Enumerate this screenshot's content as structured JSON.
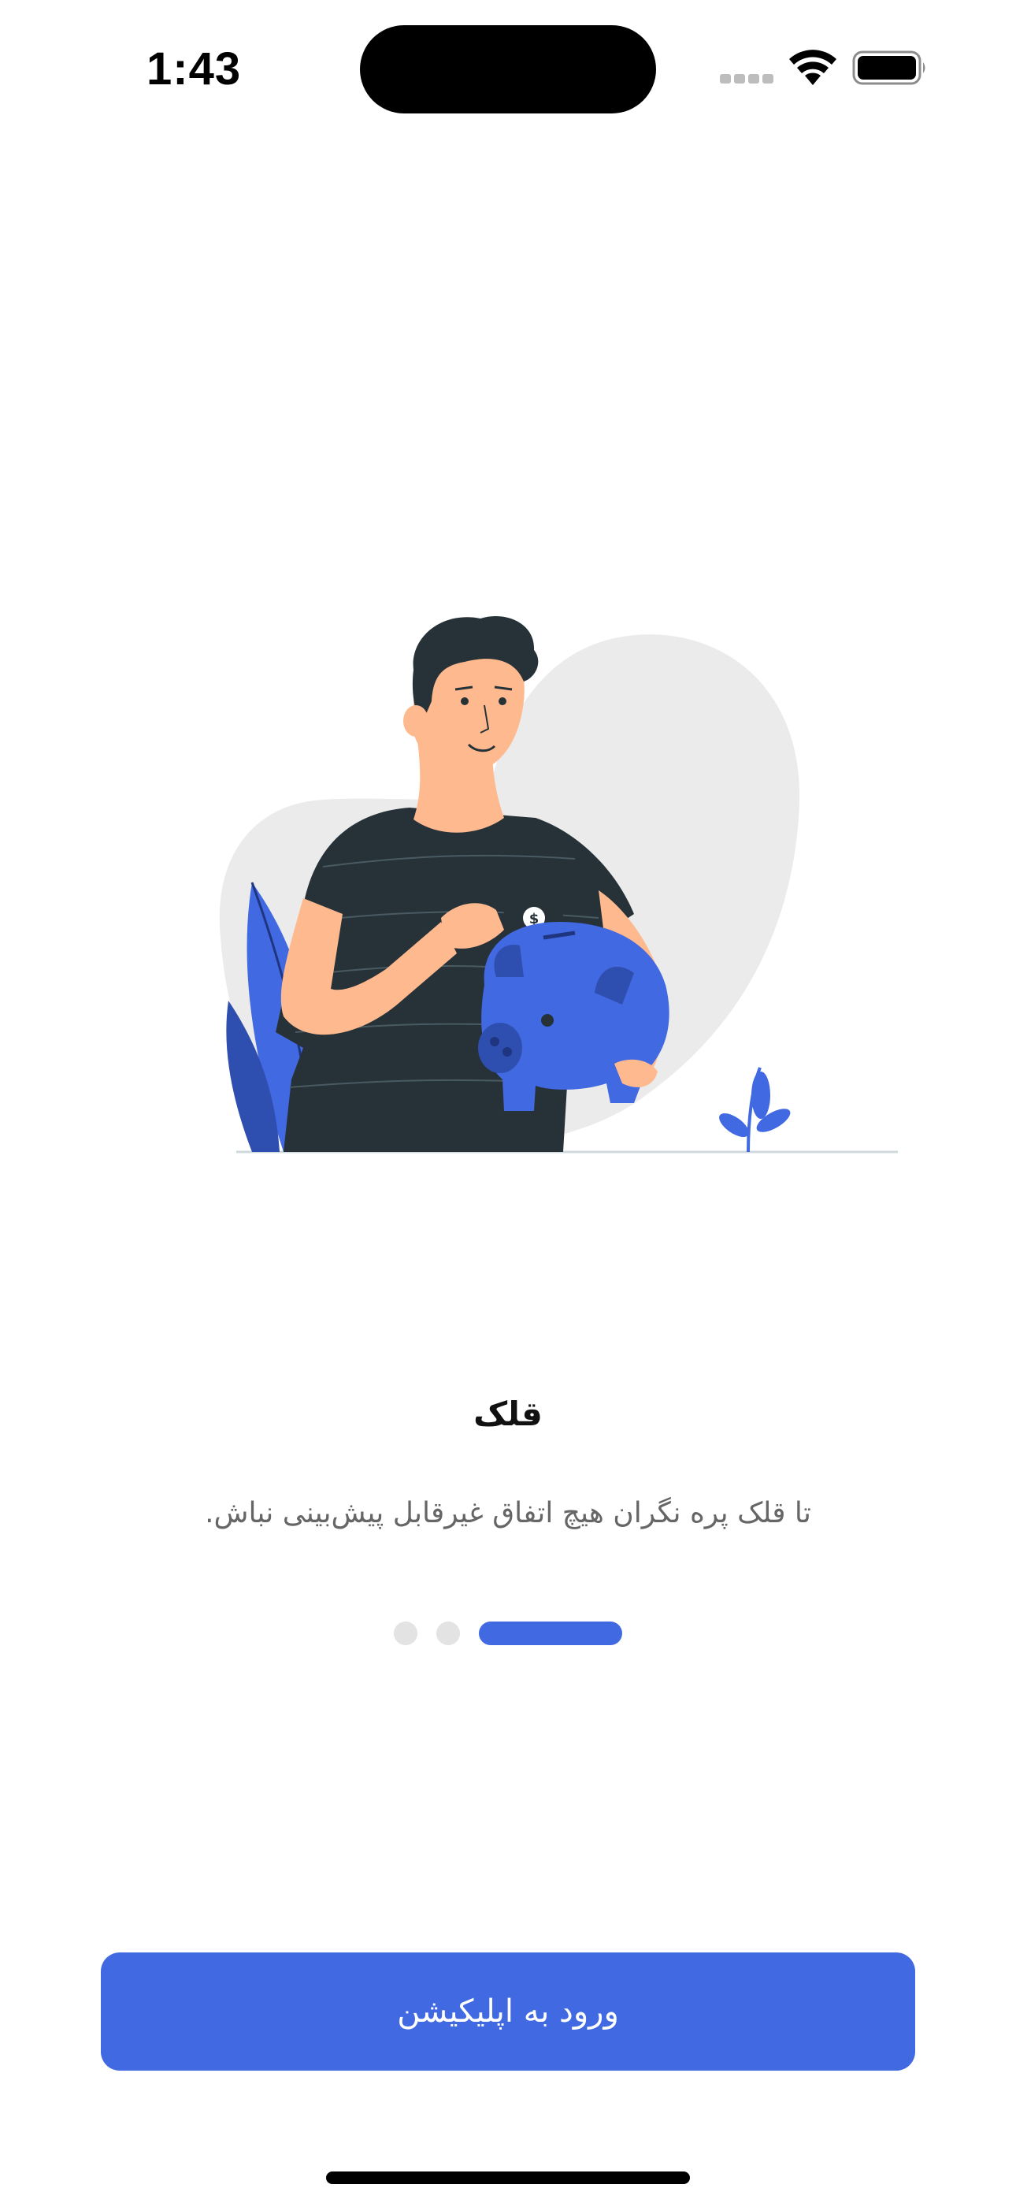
{
  "status_bar": {
    "time": "1:43",
    "icons": [
      "signal-icon",
      "wifi-icon",
      "battery-icon"
    ]
  },
  "onboarding": {
    "title": "قلک",
    "subtitle": "تا قلک پره نگران هیچ اتفاق غیرقابل پیش‌بینی نباش.",
    "illustration": "man-with-piggy-bank-illustration",
    "pager": {
      "total_pages": 3,
      "current_page": 1
    }
  },
  "cta": {
    "label": "ورود به اپلیکیشن"
  },
  "colors": {
    "accent": "#4169e1",
    "title": "#111111",
    "subtitle": "#666666",
    "inactive_dot": "#e3e3e3",
    "blob": "#ebebeb",
    "shirt": "#263238",
    "skin": "#ffb98f"
  }
}
